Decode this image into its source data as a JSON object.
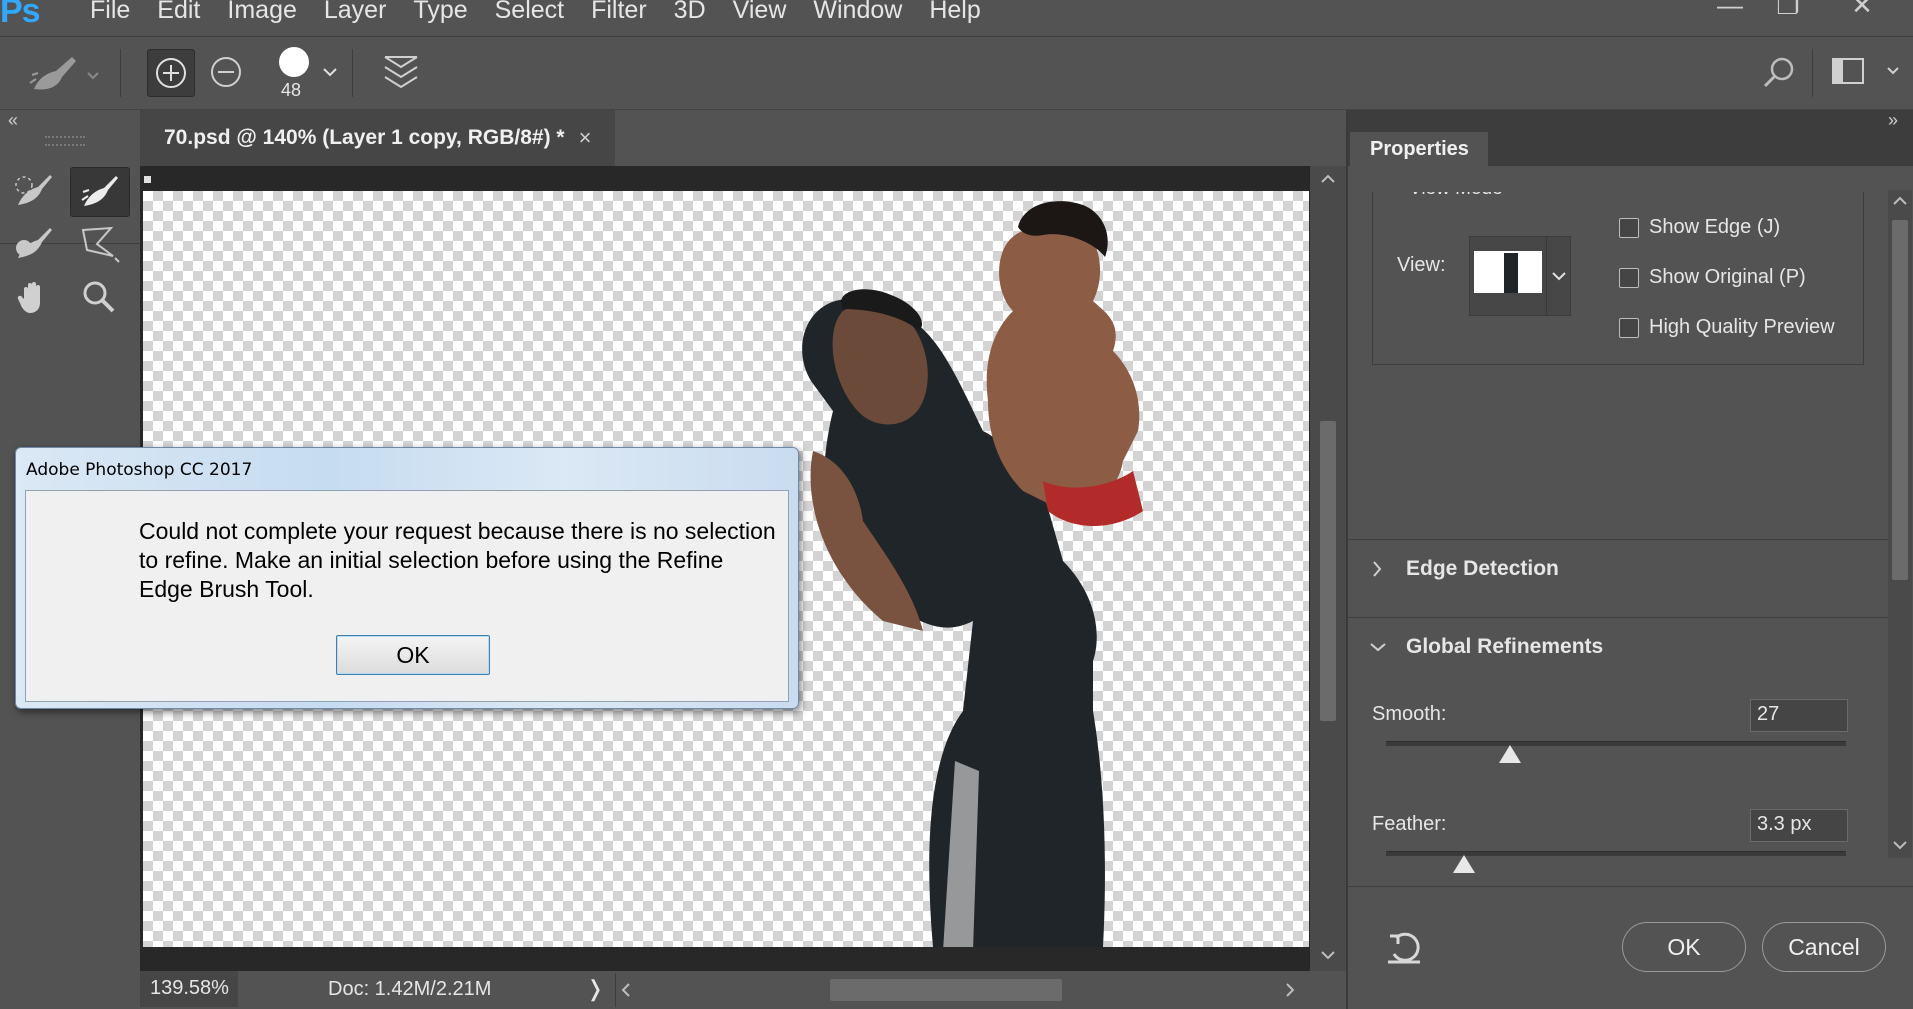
{
  "app": {
    "logo": "Ps"
  },
  "menubar": {
    "items": [
      "File",
      "Edit",
      "Image",
      "Layer",
      "Type",
      "Select",
      "Filter",
      "3D",
      "View",
      "Window",
      "Help"
    ]
  },
  "window_controls": {
    "minimize": "—",
    "restore": "❐",
    "close": "✕"
  },
  "options_bar": {
    "brush_size": "48"
  },
  "collapse": {
    "left": "«",
    "right": "»"
  },
  "document": {
    "tab_title": "70.psd @ 140% (Layer 1 copy, RGB/8#) *",
    "close": "×"
  },
  "status": {
    "zoom": "139.58%",
    "doc_size": "Doc: 1.42M/2.21M",
    "arrow": "❭"
  },
  "properties": {
    "tab": "Properties",
    "view_mode_title": "View Mode",
    "view_label": "View:",
    "checkboxes": [
      {
        "label": "Show Edge (J)",
        "checked": false
      },
      {
        "label": "Show Original (P)",
        "checked": false
      },
      {
        "label": "High Quality Preview",
        "checked": false
      }
    ],
    "edge_detection": "Edge Detection",
    "global_refinements": "Global Refinements",
    "smooth": {
      "label": "Smooth:",
      "value": "27",
      "level": 0.27
    },
    "feather": {
      "label": "Feather:",
      "value": "3.3 px",
      "level": 0.17
    },
    "ok_label": "OK",
    "cancel_label": "Cancel"
  },
  "dialog": {
    "title": "Adobe Photoshop CC 2017",
    "message": "Could not complete your request because there is no selection to refine.  Make an initial selection before using the Refine Edge Brush Tool.",
    "ok_label": "OK"
  },
  "colors": {
    "ui_bg": "#535353",
    "accent_blue": "#31a8ff"
  }
}
